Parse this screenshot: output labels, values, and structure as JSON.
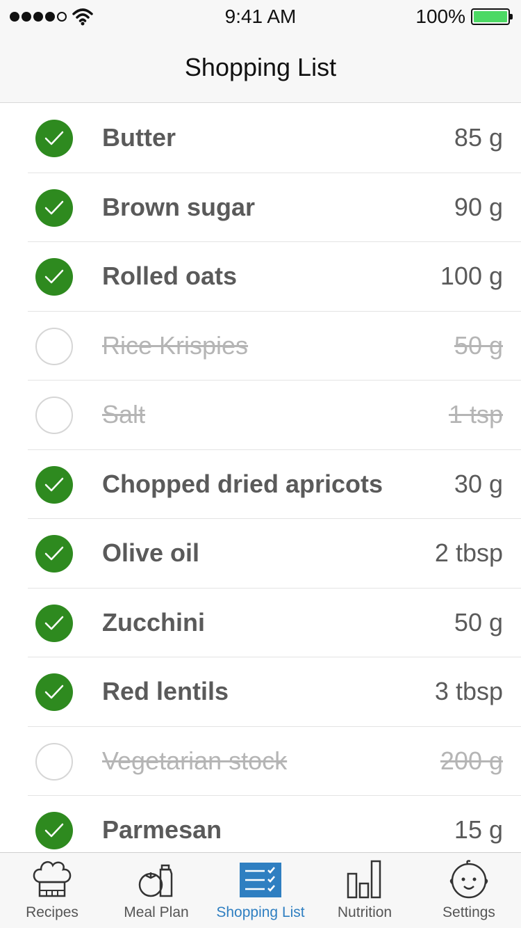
{
  "status_bar": {
    "time": "9:41 AM",
    "battery": "100%",
    "signal_icon": "signal-dots-icon",
    "wifi_icon": "wifi-icon",
    "battery_icon": "battery-icon",
    "battery_color": "#4cd964"
  },
  "nav": {
    "title": "Shopping List"
  },
  "colors": {
    "check_green": "#2e8a1f",
    "active_tab": "#2f7fc1"
  },
  "items": [
    {
      "name": "Butter",
      "qty": "85 g",
      "checked": true
    },
    {
      "name": "Brown sugar",
      "qty": "90 g",
      "checked": true
    },
    {
      "name": "Rolled oats",
      "qty": "100 g",
      "checked": true
    },
    {
      "name": "Rice Krispies",
      "qty": "50 g",
      "checked": false
    },
    {
      "name": "Salt",
      "qty": "1 tsp",
      "checked": false
    },
    {
      "name": "Chopped dried apricots",
      "qty": "30 g",
      "checked": true
    },
    {
      "name": "Olive oil",
      "qty": "2 tbsp",
      "checked": true
    },
    {
      "name": "Zucchini",
      "qty": "50 g",
      "checked": true
    },
    {
      "name": "Red lentils",
      "qty": "3 tbsp",
      "checked": true
    },
    {
      "name": "Vegetarian stock",
      "qty": "200 g",
      "checked": false
    },
    {
      "name": "Parmesan",
      "qty": "15 g",
      "checked": true
    }
  ],
  "tabs": [
    {
      "label": "Recipes",
      "icon": "chef-hat-icon",
      "active": false
    },
    {
      "label": "Meal Plan",
      "icon": "tomato-bottle-icon",
      "active": false
    },
    {
      "label": "Shopping List",
      "icon": "checklist-icon",
      "active": true
    },
    {
      "label": "Nutrition",
      "icon": "bar-chart-icon",
      "active": false
    },
    {
      "label": "Settings",
      "icon": "baby-face-icon",
      "active": false
    }
  ]
}
